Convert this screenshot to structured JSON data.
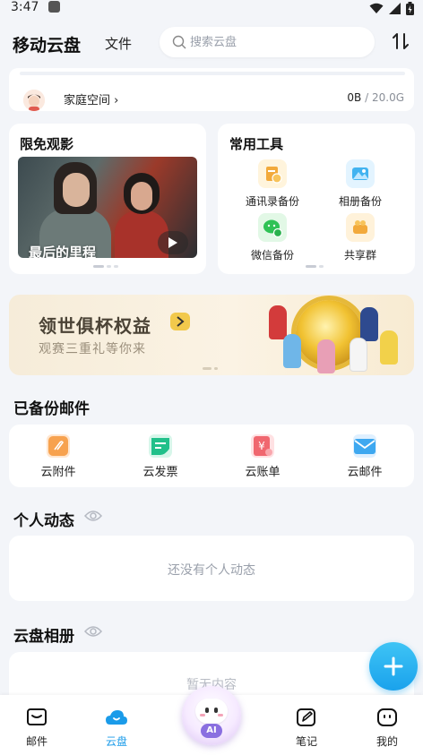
{
  "status_bar": {
    "time": "3:47"
  },
  "header": {
    "app_title": "移动云盘",
    "files_tab": "文件",
    "search_placeholder": "搜索云盘"
  },
  "family": {
    "label": "家庭空间",
    "used": "0B",
    "total": "/ 20.0G"
  },
  "movie_card": {
    "title": "限免观影",
    "caption": "最后的里程"
  },
  "tools_card": {
    "title": "常用工具",
    "tools": [
      {
        "label": "通讯录备份",
        "icon": "contacts-backup-icon"
      },
      {
        "label": "相册备份",
        "icon": "album-backup-icon"
      },
      {
        "label": "微信备份",
        "icon": "wechat-backup-icon"
      },
      {
        "label": "共享群",
        "icon": "share-group-icon"
      }
    ]
  },
  "banner": {
    "headline": "领世俱杯权益",
    "subtitle": "观赛三重礼等你来"
  },
  "backup_mail": {
    "title": "已备份邮件",
    "items": [
      {
        "label": "云附件",
        "icon": "cloud-attachment-icon"
      },
      {
        "label": "云发票",
        "icon": "cloud-invoice-icon"
      },
      {
        "label": "云账单",
        "icon": "cloud-bill-icon"
      },
      {
        "label": "云邮件",
        "icon": "cloud-mail-icon"
      }
    ]
  },
  "activity": {
    "title": "个人动态",
    "empty_text": "还没有个人动态"
  },
  "album": {
    "title": "云盘相册",
    "empty_text": "暂无内容"
  },
  "tabbar": {
    "tabs": [
      {
        "label": "邮件"
      },
      {
        "label": "云盘"
      },
      {
        "label": "AI"
      },
      {
        "label": "笔记"
      },
      {
        "label": "我的"
      }
    ],
    "active": "云盘"
  },
  "colors": {
    "accent": "#1a9be9",
    "fab": "#28b4f0",
    "banner_bg": "#f8eedc"
  }
}
